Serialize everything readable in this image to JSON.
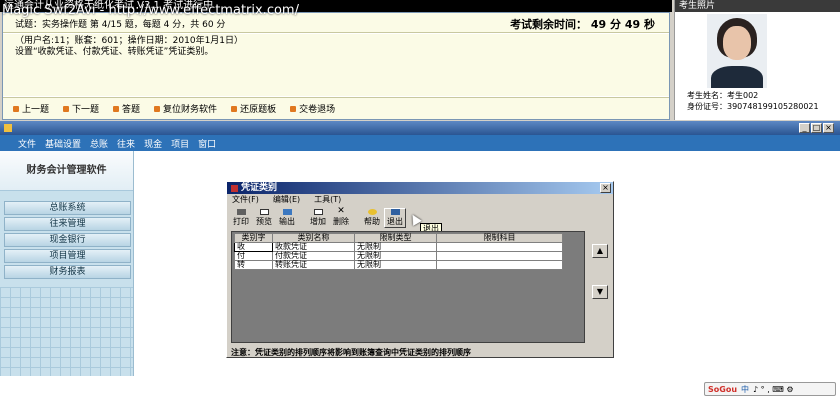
{
  "exam": {
    "window_title": "运通会计从业资格无纸化考试 V3.1 考试进行中",
    "question_info": "试题：实务操作题 第 4/15 题，每题 4 分，共 60 分",
    "timer": "考试剩余时间： 49 分 49 秒",
    "user_line": "（用户名:11；账套：601；操作日期：2010年1月1日）",
    "prompt": "设置“收款凭证、付款凭证、转账凭证”凭证类别。",
    "toolbar": [
      "上一题",
      "下一题",
      "答题",
      "复位财务软件",
      "还原题板",
      "交卷退场"
    ]
  },
  "candidate": {
    "panel_title": "考生照片",
    "name_line": "考生姓名：考生002",
    "id_line": "身份证号：390748199105280021"
  },
  "app": {
    "menu": [
      "文件",
      "基础设置",
      "总账",
      "往来",
      "现金",
      "项目",
      "窗口"
    ],
    "sidebar_logo": "财务会计管理软件",
    "sidebar_items": [
      "总账系统",
      "往来管理",
      "现金银行",
      "项目管理",
      "财务报表"
    ],
    "window_buttons": [
      "_",
      "□",
      "×"
    ]
  },
  "dialog": {
    "title": "凭证类别",
    "close": "×",
    "menu": [
      "文件(F)",
      "编辑(E)",
      "工具(T)"
    ],
    "tools": [
      "打印",
      "预览",
      "输出",
      "增加",
      "删除",
      "帮助",
      "退出"
    ],
    "tooltip": "退出",
    "columns": [
      "类别字",
      "类别名称",
      "限制类型",
      "限制科目"
    ],
    "rows": [
      [
        "收",
        "收款凭证",
        "无限制",
        ""
      ],
      [
        "付",
        "付款凭证",
        "无限制",
        ""
      ],
      [
        "转",
        "转账凭证",
        "无限制",
        ""
      ]
    ],
    "scroll_up": "▲",
    "scroll_down": "▼",
    "note": "注意：凭证类别的排列顺序将影响到账簿查询中凭证类别的排列顺序"
  },
  "watermark": "Magic Swf2Avi - http://www.effectmatrix.com/",
  "ime": {
    "brand": "SoGou",
    "mode": "中",
    "symbols": "♪ ° , ⌨ ⚙"
  }
}
